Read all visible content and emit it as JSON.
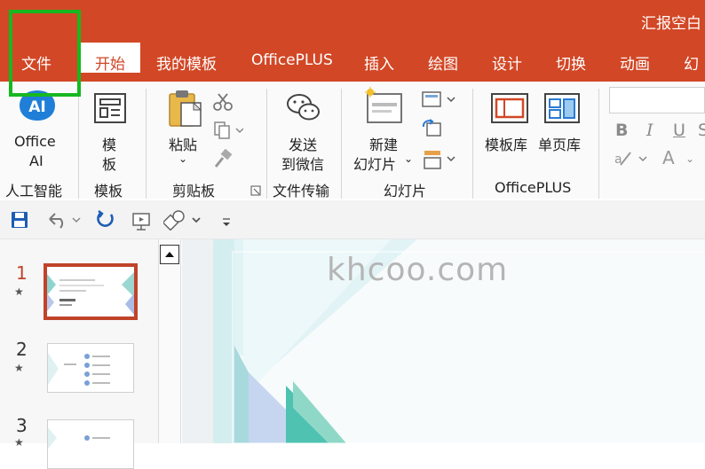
{
  "window": {
    "title": "汇报空白"
  },
  "tabs": [
    {
      "label": "文件"
    },
    {
      "label": "开始"
    },
    {
      "label": "我的模板"
    },
    {
      "label": "OfficePLUS"
    },
    {
      "label": "插入"
    },
    {
      "label": "绘图"
    },
    {
      "label": "设计"
    },
    {
      "label": "切换"
    },
    {
      "label": "动画"
    },
    {
      "label": "幻"
    }
  ],
  "ribbon": {
    "ai": {
      "line1": "Office",
      "line2": "AI",
      "group": "人工智能"
    },
    "template": {
      "line1": "模",
      "line2": "板",
      "group": "模板"
    },
    "clipboard": {
      "paste": "粘贴",
      "group": "剪贴板"
    },
    "transfer": {
      "line1": "发送",
      "line2": "到微信",
      "group": "文件传输"
    },
    "slides": {
      "line1": "新建",
      "line2": "幻灯片",
      "group": "幻灯片"
    },
    "officeplus": {
      "lib1": "模板库",
      "lib2": "单页库",
      "group": "OfficePLUS"
    },
    "font": {
      "bold": "B",
      "italic": "I",
      "underline": "U",
      "strike": "S",
      "fontcolor": "A"
    }
  },
  "slides": [
    {
      "number": "1"
    },
    {
      "number": "2"
    },
    {
      "number": "3"
    }
  ],
  "watermark": "khcoo.com",
  "colors": {
    "accent": "#d24726",
    "highlight": "#16b81f",
    "selected_slide": "#c0432a"
  }
}
